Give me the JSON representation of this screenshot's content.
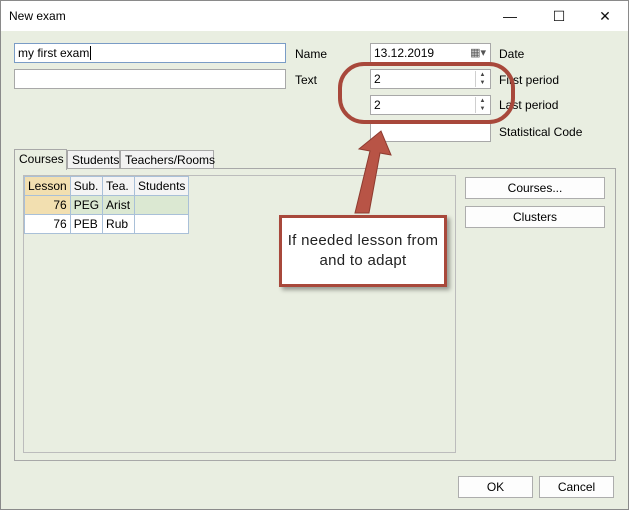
{
  "window": {
    "title": "New exam",
    "controls": {
      "minimize": "—",
      "maximize": "☐",
      "close": "✕"
    }
  },
  "form": {
    "name_value": "my first exam",
    "text_value": "",
    "name_label": "Name",
    "text_label": "Text",
    "date_value": "13.12.2019",
    "date_label": "Date",
    "first_period_value": "2",
    "first_period_label": "First period",
    "last_period_value": "2",
    "last_period_label": "Last period",
    "statistical_code_value": "",
    "statistical_code_label": "Statistical Code"
  },
  "tabs": [
    {
      "label": "Courses",
      "active": true
    },
    {
      "label": "Students",
      "active": false
    },
    {
      "label": "Teachers/Rooms",
      "active": false
    }
  ],
  "grid": {
    "columns": [
      "Lesson",
      "Sub.",
      "Tea.",
      "Students"
    ],
    "rows": [
      {
        "lesson": "76",
        "subject": "PEG",
        "teacher": "Arist",
        "students": ""
      },
      {
        "lesson": "76",
        "subject": "PEB",
        "teacher": "Rub",
        "students": ""
      }
    ]
  },
  "side_buttons": {
    "courses": "Courses...",
    "clusters": "Clusters"
  },
  "footer": {
    "ok": "OK",
    "cancel": "Cancel"
  },
  "annotation": {
    "line1": "If needed lesson from",
    "line2": "and to adapt",
    "color": "#a8483b"
  }
}
